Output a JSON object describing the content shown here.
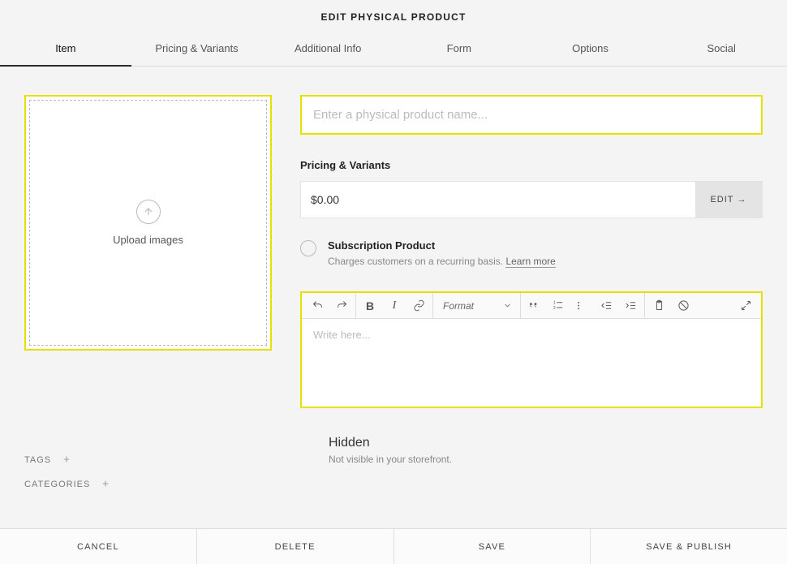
{
  "page_title": "EDIT PHYSICAL PRODUCT",
  "tabs": [
    {
      "label": "Item",
      "active": true
    },
    {
      "label": "Pricing & Variants",
      "active": false
    },
    {
      "label": "Additional Info",
      "active": false
    },
    {
      "label": "Form",
      "active": false
    },
    {
      "label": "Options",
      "active": false
    },
    {
      "label": "Social",
      "active": false
    }
  ],
  "upload": {
    "label": "Upload images"
  },
  "name_input": {
    "placeholder": "Enter a physical product name..."
  },
  "pricing": {
    "section_title": "Pricing & Variants",
    "price": "$0.00",
    "edit_label": "EDIT"
  },
  "subscription": {
    "title": "Subscription Product",
    "desc_prefix": "Charges customers on a recurring basis. ",
    "learn_more": "Learn more"
  },
  "editor": {
    "format_label": "Format",
    "placeholder": "Write here..."
  },
  "meta": {
    "tags_label": "TAGS",
    "categories_label": "CATEGORIES"
  },
  "visibility": {
    "title": "Hidden",
    "desc": "Not visible in your storefront."
  },
  "footer": {
    "cancel": "CANCEL",
    "delete": "DELETE",
    "save": "SAVE",
    "save_publish": "SAVE & PUBLISH"
  }
}
